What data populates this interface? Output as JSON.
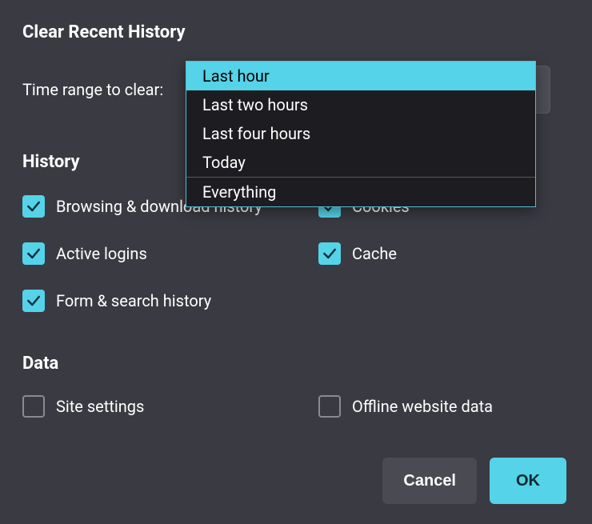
{
  "dialog": {
    "title": "Clear Recent History"
  },
  "time": {
    "label": "Time range to clear:",
    "options": [
      "Last hour",
      "Last two hours",
      "Last four hours",
      "Today",
      "Everything"
    ],
    "highlighted": "Last hour"
  },
  "sections": {
    "history": "History",
    "data": "Data"
  },
  "history_items": {
    "browsing": {
      "label": "Browsing & download history",
      "checked": true
    },
    "cookies": {
      "label": "Cookies",
      "checked": true
    },
    "logins": {
      "label": "Active logins",
      "checked": true
    },
    "cache": {
      "label": "Cache",
      "checked": true
    },
    "form": {
      "label": "Form & search history",
      "checked": true
    }
  },
  "data_items": {
    "site": {
      "label": "Site settings",
      "checked": false
    },
    "offline": {
      "label": "Offline website data",
      "checked": false
    }
  },
  "buttons": {
    "cancel": "Cancel",
    "ok": "OK"
  },
  "colors": {
    "accent": "#55d3e8",
    "bg": "#3a3a42",
    "dropdown_bg": "#1d1d21"
  }
}
